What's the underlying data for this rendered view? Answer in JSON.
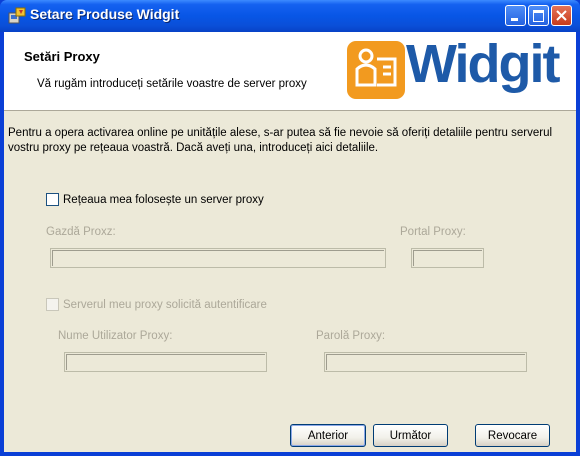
{
  "window": {
    "title": "Setare Produse Widgit",
    "minimize_icon": "minimize-icon",
    "maximize_icon": "maximize-icon",
    "close_icon": "close-icon",
    "app_icon": "installer-icon"
  },
  "header": {
    "title": "Setări Proxy",
    "subtitle": "Vă rugăm introduceți setările voastre de server proxy",
    "logo_text": "Widgit",
    "logo_colors": {
      "badge": "#f29a1f",
      "word": "#1e5aa8"
    }
  },
  "description": "Pentru a opera activarea online pe unitățile alese, s-ar putea să fie nevoie să oferiți detaliile pentru serverul vostru proxy pe rețeaua voastră. Dacă aveți una, introduceți aici detaliile.",
  "proxy": {
    "checkbox_label": "Rețeaua mea folosește un server proxy",
    "checked": false,
    "host_label": "Gazdă Proxz:",
    "host_value": "",
    "port_label": "Portal Proxy:",
    "port_value": ""
  },
  "auth": {
    "checkbox_label": "Serverul meu proxy solicită autentificare",
    "checked": false,
    "enabled": false,
    "username_label": "Nume Utilizator Proxy:",
    "username_value": "",
    "password_label": "Parolă Proxy:",
    "password_value": ""
  },
  "buttons": {
    "back": "Anterior",
    "next": "Următor",
    "cancel": "Revocare"
  }
}
